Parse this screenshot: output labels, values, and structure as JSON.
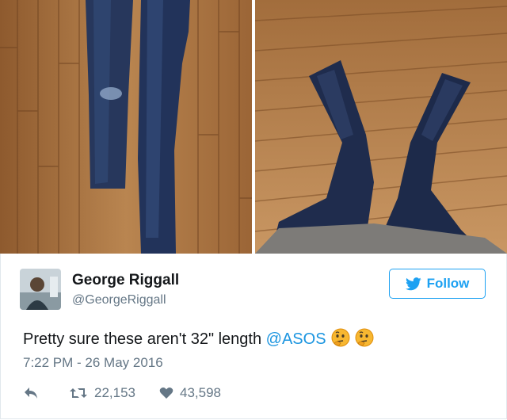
{
  "tweet": {
    "author_name": "George Riggall",
    "author_handle": "@GeorgeRiggall",
    "follow_label": "Follow",
    "text_before": "Pretty sure these aren't 32\" length ",
    "mention": "@ASOS",
    "emoji": [
      "thinking-face",
      "thinking-face"
    ],
    "timestamp": "7:22 PM - 26 May 2016",
    "retweets": "22,153",
    "likes": "43,598"
  },
  "colors": {
    "accent": "#1da1f2",
    "link": "#1b95e0",
    "text": "#14171a",
    "muted": "#657786",
    "floor": "#b07a45",
    "denim": "#27375c"
  }
}
